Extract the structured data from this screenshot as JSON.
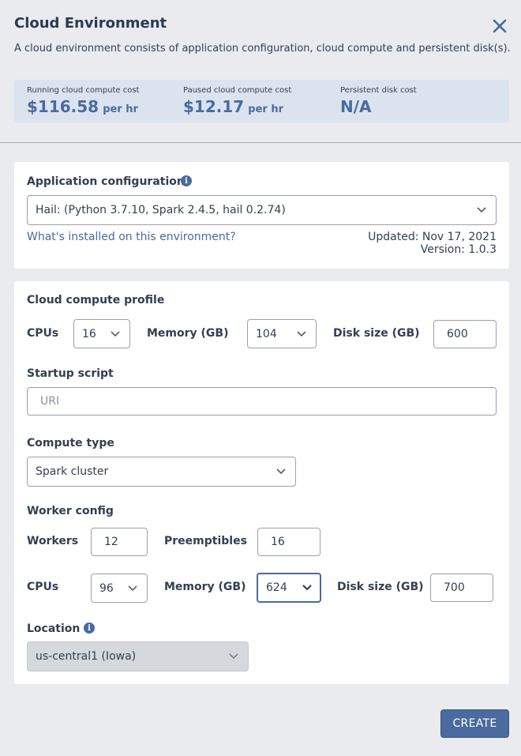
{
  "header": {
    "title": "Cloud Environment",
    "description": "A cloud environment consists of application configuration, cloud compute and persistent disk(s)."
  },
  "costs": {
    "running_label": "Running cloud compute cost",
    "running_value": "$116.58",
    "running_unit": "per hr",
    "paused_label": "Paused cloud compute cost",
    "paused_value": "$12.17",
    "paused_unit": "per hr",
    "disk_label": "Persistent disk cost",
    "disk_value": "N/A"
  },
  "app_config": {
    "label": "Application configuration",
    "selected": "Hail: (Python 3.7.10, Spark 2.4.5, hail 0.2.74)",
    "link": "What's installed on this environment?",
    "updated": "Updated: Nov 17, 2021",
    "version": "Version: 1.0.3"
  },
  "compute": {
    "section_label": "Cloud compute profile",
    "cpus_label": "CPUs",
    "cpus_value": "16",
    "memory_label": "Memory (GB)",
    "memory_value": "104",
    "disk_label": "Disk size (GB)",
    "disk_value": "600",
    "startup_label": "Startup script",
    "startup_placeholder": "URI",
    "type_label": "Compute type",
    "type_value": "Spark cluster",
    "worker_label": "Worker config",
    "workers_label": "Workers",
    "workers_value": "12",
    "preemptibles_label": "Preemptibles",
    "preemptibles_value": "16",
    "worker_cpus_label": "CPUs",
    "worker_cpus_value": "96",
    "worker_memory_label": "Memory (GB)",
    "worker_memory_value": "624",
    "worker_disk_label": "Disk size (GB)",
    "worker_disk_value": "700",
    "location_label": "Location",
    "location_value": "us-central1 (Iowa)"
  },
  "actions": {
    "create_label": "CREATE"
  },
  "colors": {
    "accent": "#4a6aa0",
    "background": "#e9ebee",
    "cost_box": "#dbe3ee"
  }
}
